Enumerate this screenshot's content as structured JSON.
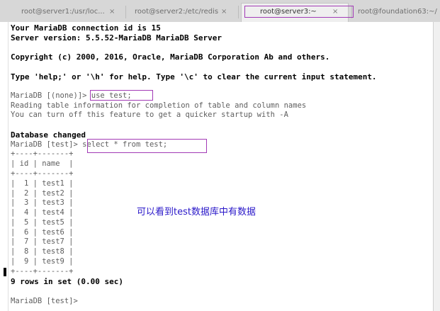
{
  "tabs": [
    {
      "label": "root@server1:/usr/loc...",
      "close": "×"
    },
    {
      "label": "root@server2:/etc/redis",
      "close": "×"
    },
    {
      "label": "root@server3:~",
      "close": "×",
      "active": true
    },
    {
      "label": "root@foundation63:~/"
    }
  ],
  "terminal": {
    "lines": [
      "Your MariaDB connection id is 15",
      "Server version: 5.5.52-MariaDB MariaDB Server",
      "",
      "Copyright (c) 2000, 2016, Oracle, MariaDB Corporation Ab and others.",
      "",
      "Type 'help;' or '\\h' for help. Type '\\c' to clear the current input statement.",
      "",
      "MariaDB [(none)]> use test;",
      "Reading table information for completion of table and column names",
      "You can turn off this feature to get a quicker startup with -A",
      "",
      "Database changed",
      "MariaDB [test]> select * from test;",
      "+----+-------+",
      "| id | name  |",
      "+----+-------+",
      "|  1 | test1 |",
      "|  2 | test2 |",
      "|  3 | test3 |",
      "|  4 | test4 |",
      "|  5 | test5 |",
      "|  6 | test6 |",
      "|  7 | test7 |",
      "|  8 | test8 |",
      "|  9 | test9 |",
      "+----+-------+",
      "9 rows in set (0.00 sec)",
      "",
      "MariaDB [test]>"
    ]
  },
  "annotation": "可以看到test数据库中有数据",
  "colors": {
    "highlight": "#a23ab6",
    "annotation": "#2a18c9"
  }
}
